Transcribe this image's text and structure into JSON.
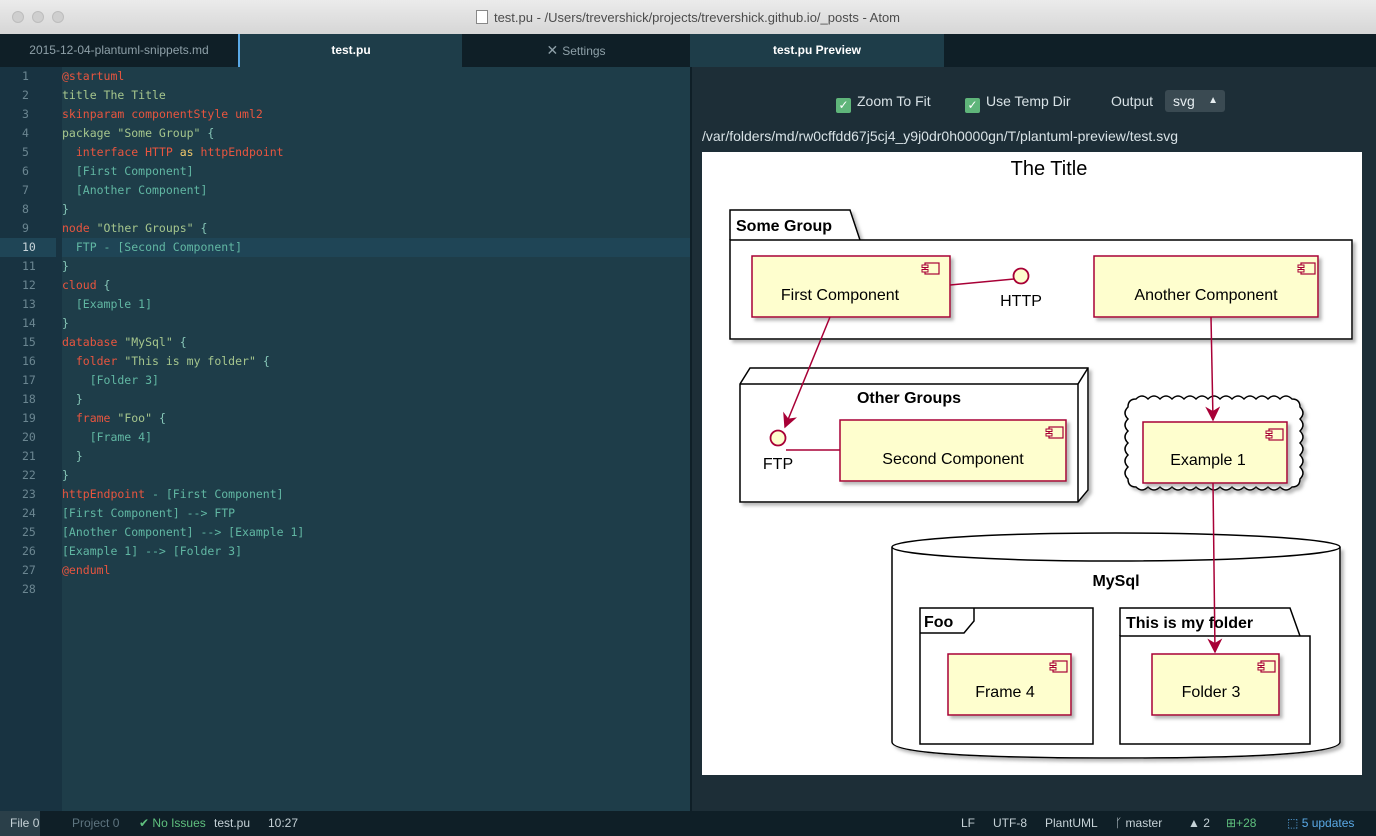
{
  "window": {
    "title": "test.pu - /Users/trevershick/projects/trevershick.github.io/_posts - Atom"
  },
  "tabs": [
    {
      "label": "2015-12-04-plantuml-snippets.md",
      "active": false
    },
    {
      "label": "test.pu",
      "active": true
    },
    {
      "label": "Settings",
      "icon": "wrench-icon",
      "active": false
    },
    {
      "label": "test.pu Preview",
      "active": true
    }
  ],
  "editor": {
    "current_line": 10,
    "line_numbers": [
      "1",
      "2",
      "3",
      "4",
      "5",
      "6",
      "7",
      "8",
      "9",
      "10",
      "11",
      "12",
      "13",
      "14",
      "15",
      "16",
      "17",
      "18",
      "19",
      "20",
      "21",
      "22",
      "23",
      "24",
      "25",
      "26",
      "27",
      "28"
    ],
    "lines": [
      [
        {
          "t": "@startuml",
          "c": "kw"
        }
      ],
      [
        {
          "t": "title ",
          "c": "txt"
        },
        {
          "t": "The Title",
          "c": "txt"
        }
      ],
      [
        {
          "t": "skinparam ",
          "c": "kw"
        },
        {
          "t": "componentStyle uml2",
          "c": "kw"
        }
      ],
      [
        {
          "t": "package ",
          "c": "txt"
        },
        {
          "t": "\"Some Group\"",
          "c": "txt"
        },
        {
          "t": " {",
          "c": "plain"
        }
      ],
      [
        {
          "t": "  ",
          "c": "plain"
        },
        {
          "t": "interface ",
          "c": "kw"
        },
        {
          "t": "HTTP",
          "c": "kw"
        },
        {
          "t": " as ",
          "c": "str"
        },
        {
          "t": "httpEndpoint",
          "c": "kw"
        }
      ],
      [
        {
          "t": "  [First Component]",
          "c": "comp"
        }
      ],
      [
        {
          "t": "  [Another Component]",
          "c": "comp"
        }
      ],
      [
        {
          "t": "}",
          "c": "plain"
        }
      ],
      [
        {
          "t": "node ",
          "c": "kw"
        },
        {
          "t": "\"Other Groups\"",
          "c": "txt"
        },
        {
          "t": " {",
          "c": "plain"
        }
      ],
      [
        {
          "t": "  FTP - [Second Component]",
          "c": "comp"
        }
      ],
      [
        {
          "t": "}",
          "c": "plain"
        }
      ],
      [
        {
          "t": "cloud ",
          "c": "kw"
        },
        {
          "t": "{",
          "c": "plain"
        }
      ],
      [
        {
          "t": "  [Example 1]",
          "c": "comp"
        }
      ],
      [
        {
          "t": "}",
          "c": "plain"
        }
      ],
      [
        {
          "t": "database ",
          "c": "kw"
        },
        {
          "t": "\"MySql\"",
          "c": "txt"
        },
        {
          "t": " {",
          "c": "plain"
        }
      ],
      [
        {
          "t": "  ",
          "c": "plain"
        },
        {
          "t": "folder ",
          "c": "kw"
        },
        {
          "t": "\"This is my folder\"",
          "c": "txt"
        },
        {
          "t": " {",
          "c": "plain"
        }
      ],
      [
        {
          "t": "    [Folder 3]",
          "c": "comp"
        }
      ],
      [
        {
          "t": "  }",
          "c": "plain"
        }
      ],
      [
        {
          "t": "  ",
          "c": "plain"
        },
        {
          "t": "frame ",
          "c": "kw"
        },
        {
          "t": "\"Foo\"",
          "c": "txt"
        },
        {
          "t": " {",
          "c": "plain"
        }
      ],
      [
        {
          "t": "    [Frame 4]",
          "c": "comp"
        }
      ],
      [
        {
          "t": "  }",
          "c": "plain"
        }
      ],
      [
        {
          "t": "}",
          "c": "plain"
        }
      ],
      [
        {
          "t": "httpEndpoint",
          "c": "kw"
        },
        {
          "t": " - [First Component]",
          "c": "comp"
        }
      ],
      [
        {
          "t": "[First Component] --> FTP",
          "c": "comp"
        }
      ],
      [
        {
          "t": "[Another Component] --> [Example 1]",
          "c": "comp"
        }
      ],
      [
        {
          "t": "[Example 1] --> [Folder 3]",
          "c": "comp"
        }
      ],
      [
        {
          "t": "@enduml",
          "c": "kw"
        }
      ],
      []
    ]
  },
  "preview": {
    "zoom_to_fit_label": "Zoom To Fit",
    "zoom_to_fit_checked": true,
    "use_temp_dir_label": "Use Temp Dir",
    "use_temp_dir_checked": true,
    "output_label": "Output",
    "output_value": "svg",
    "svg_path": "/var/folders/md/rw0cffdd67j5cj4_y9j0dr0h0000gn/T/plantuml-preview/test.svg",
    "diagram": {
      "title": "The Title",
      "some_group": "Some Group",
      "first_component": "First Component",
      "http": "HTTP",
      "another_component": "Another Component",
      "other_groups": "Other Groups",
      "ftp": "FTP",
      "second_component": "Second Component",
      "example_1": "Example 1",
      "mysql": "MySql",
      "foo": "Foo",
      "this_is_my_folder": "This is my folder",
      "frame_4": "Frame 4",
      "folder_3": "Folder 3"
    }
  },
  "statusbar": {
    "file_label": "File",
    "file_count": "0",
    "project_label": "Project",
    "project_count": "0",
    "issues": "No Issues",
    "filename": "test.pu",
    "cursor": "10:27",
    "line_ending": "LF",
    "encoding": "UTF-8",
    "grammar": "PlantUML",
    "branch": "master",
    "ahead": "2",
    "added": "+28",
    "updates": "5 updates"
  },
  "colors": {
    "editor_bg": "#1e3d49",
    "keyword": "#e8553f",
    "string": "#f2c86b",
    "component": "#61b7a3",
    "component_fill": "#fefece",
    "component_stroke": "#a80036"
  }
}
